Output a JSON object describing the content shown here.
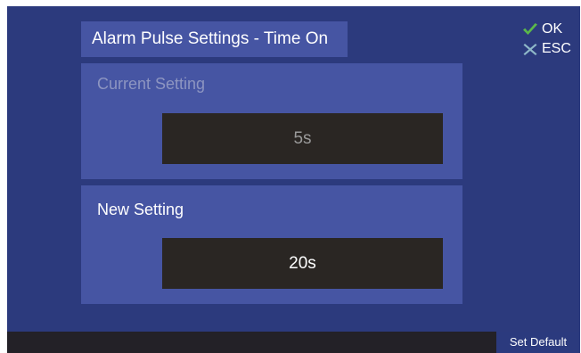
{
  "header": {
    "title": "Alarm Pulse Settings - Time On"
  },
  "actions": {
    "ok_label": "OK",
    "esc_label": "ESC",
    "ok_icon": "checkmark-icon",
    "esc_icon": "x-icon"
  },
  "current_setting": {
    "label": "Current Setting",
    "value": "5s"
  },
  "new_setting": {
    "label": "New Setting",
    "value": "20s"
  },
  "footer": {
    "set_default_label": "Set Default"
  },
  "colors": {
    "background": "#2c3a7d",
    "panel": "#4655a3",
    "value_box": "#2a2623",
    "ok_green": "#5bb84a",
    "esc_teal": "#8fb8c8",
    "bottom_bar": "#232127"
  }
}
